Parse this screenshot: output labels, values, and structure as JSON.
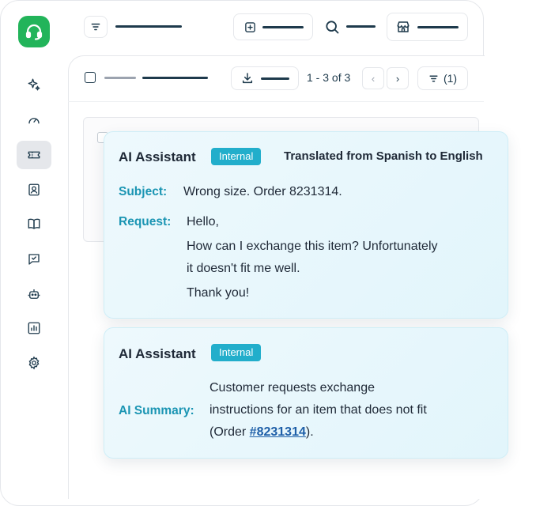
{
  "toolbar": {
    "pager": "1 - 3 of 3",
    "prev_label": "‹",
    "next_label": "›",
    "filter_count": "(1)"
  },
  "card1": {
    "title": "AI Assistant",
    "badge": "Internal",
    "translated": "Translated from Spanish to English",
    "subject_label": "Subject:",
    "subject_value": "Wrong size. Order 8231314.",
    "request_label": "Request:",
    "request_lines": [
      "Hello,",
      "How can I exchange this item? Unfortunately",
      "it doesn't fit me well.",
      "Thank you!"
    ]
  },
  "card2": {
    "title": "AI Assistant",
    "badge": "Internal",
    "summary_label": "AI Summary:",
    "summary_line1": "Customer requests exchange",
    "summary_line2": "instructions for an item that does not fit",
    "summary_prefix": "(Order ",
    "summary_link": "#8231314",
    "summary_suffix": ")."
  },
  "icons": [
    "headset-icon",
    "sparkles-icon",
    "gauge-icon",
    "ticket-icon",
    "contact-icon",
    "book-icon",
    "message-check-icon",
    "bot-icon",
    "chart-icon",
    "gear-icon",
    "menu-icon",
    "plus-square-icon",
    "search-icon",
    "store-icon",
    "download-icon",
    "filter-icon"
  ],
  "colors": {
    "brand": "#22b45a",
    "accent": "#22aecb",
    "label": "#1b95b3",
    "ink": "#1e3a4c"
  }
}
